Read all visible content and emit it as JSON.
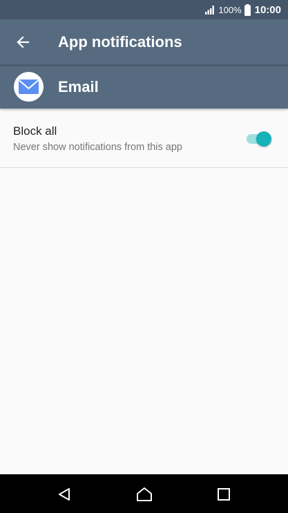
{
  "status_bar": {
    "battery_percent": "100%",
    "time": "10:00",
    "icons": [
      "signal-icon",
      "battery-icon"
    ]
  },
  "toolbar": {
    "title": "App notifications",
    "back_icon": "arrow-left-icon"
  },
  "app": {
    "name": "Email",
    "icon": "email-envelope-icon"
  },
  "settings": [
    {
      "title": "Block all",
      "summary": "Never show notifications from this app",
      "toggle_on": true
    }
  ],
  "nav_bar": {
    "icons": [
      "back-triangle-icon",
      "home-icon",
      "recents-icon"
    ]
  },
  "colors": {
    "status_bar": "#45566a",
    "toolbar": "#566b80",
    "accent": "#16b2b7",
    "accent_track": "#9fdfe0"
  }
}
